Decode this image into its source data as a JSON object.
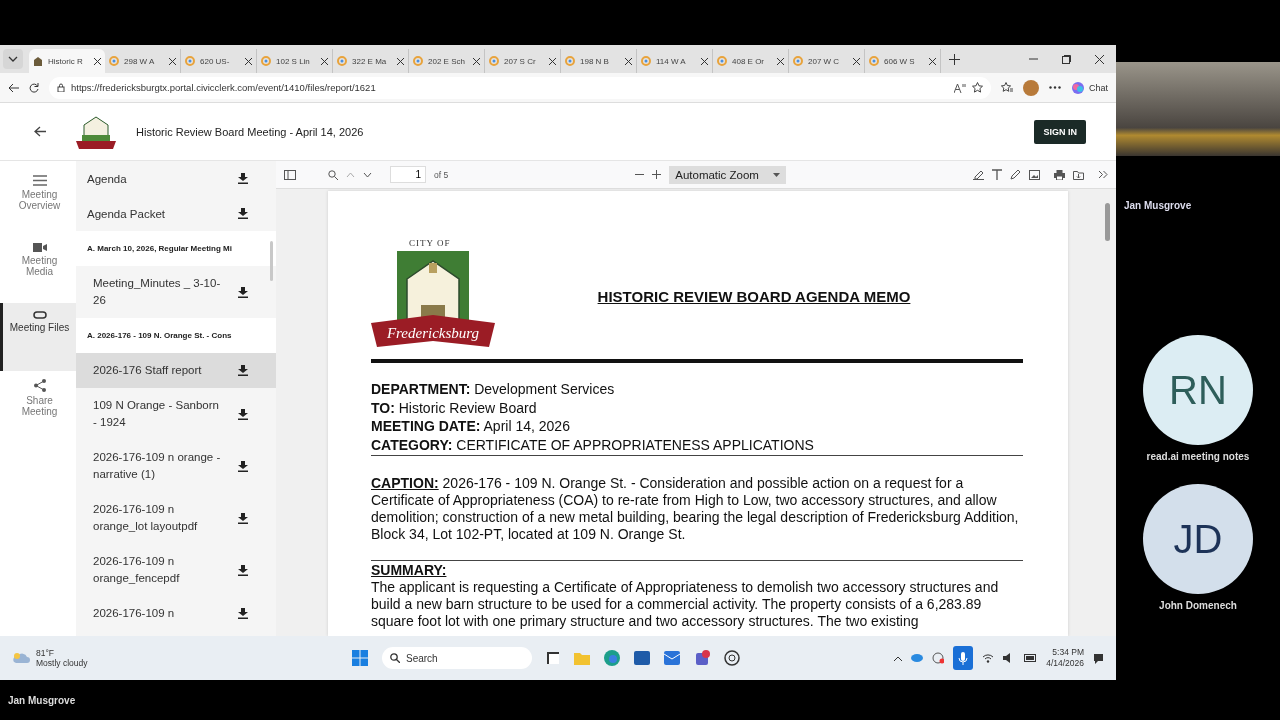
{
  "browser": {
    "tabs": [
      {
        "title": "Historic R",
        "selected": true
      },
      {
        "title": "298 W A",
        "selected": false
      },
      {
        "title": "620 US-",
        "selected": false
      },
      {
        "title": "102 S Lin",
        "selected": false
      },
      {
        "title": "322 E Ma",
        "selected": false
      },
      {
        "title": "202 E Sch",
        "selected": false
      },
      {
        "title": "207 S Cr",
        "selected": false
      },
      {
        "title": "198 N B",
        "selected": false
      },
      {
        "title": "114 W A",
        "selected": false
      },
      {
        "title": "408 E Or",
        "selected": false
      },
      {
        "title": "207 W C",
        "selected": false
      },
      {
        "title": "606 W S",
        "selected": false
      }
    ],
    "address": "https://fredericksburgtx.portal.civicclerk.com/event/1410/files/report/1621",
    "chat": "Chat"
  },
  "site_header": {
    "title": "Historic Review Board Meeting - April 14, 2026",
    "sign_in": "SIGN IN"
  },
  "nav": [
    {
      "kind": "menu",
      "label": "Meeting Overview",
      "selected": false
    },
    {
      "kind": "video",
      "label": "Meeting Media",
      "selected": false
    },
    {
      "kind": "clip",
      "label": "Meeting Files",
      "selected": true
    },
    {
      "kind": "share",
      "label": "Share Meeting",
      "selected": false
    }
  ],
  "files": [
    {
      "kind": "document",
      "name": "Agenda",
      "selected": false
    },
    {
      "kind": "document",
      "name": "Agenda Packet",
      "selected": false
    },
    {
      "kind": "heading",
      "name": "A. March 10, 2026, Regular Meeting Mi"
    },
    {
      "kind": "attachment",
      "name": "Meeting_Minutes _ 3-10-26",
      "selected": false
    },
    {
      "kind": "heading",
      "name": "A. 2026-176 - 109 N. Orange St. - Cons"
    },
    {
      "kind": "attachment",
      "name": "2026-176 Staff report",
      "selected": true
    },
    {
      "kind": "attachment",
      "name": "109 N Orange - Sanborn - 1924",
      "selected": false
    },
    {
      "kind": "attachment",
      "name": "2026-176-109 n orange - narrative (1)",
      "selected": false
    },
    {
      "kind": "attachment",
      "name": "2026-176-109 n orange_lot layoutpdf",
      "selected": false
    },
    {
      "kind": "attachment",
      "name": "2026-176-109 n orange_fencepdf",
      "selected": false
    },
    {
      "kind": "attachment",
      "name": "2026-176-109 n",
      "selected": false
    }
  ],
  "viewer": {
    "page": "1",
    "page_count": "of 5",
    "zoom": "Automatic Zoom"
  },
  "memo": {
    "logo_top": "CITY OF",
    "logo_ribbon": "Fredericksburg",
    "title": "HISTORIC REVIEW BOARD AGENDA MEMO",
    "fields": [
      "**DEPARTMENT:** Development Services",
      "**TO:** Historic Review Board",
      "**MEETING DATE:** April 14, 2026",
      "**CATEGORY:** CERTIFICATE OF APPROPRIATENESS APPLICATIONS"
    ],
    "caption": "**CAPTION:** 2026-176 - 109 N. Orange St. - Consideration and possible action on a request for a Certificate of Appropriateness (COA) to re-rate from High to Low, two accessory structures, and allow demolition; construction of a new metal building, bearing the legal description of Fredericksburg Addition, Block 34, Lot 102-PT, located at 109 N. Orange St.",
    "summary_heading": "SUMMARY:",
    "summary": "The applicant is requesting a Certificate of Appropriateness to demolish two accessory structures and build a new barn structure to be used for a commercial activity. The property consists of a 6,283.89 square foot lot with one primary structure and two accessory structures.  The two existing"
  },
  "taskbar": {
    "temperature": "81°F",
    "weather": "Mostly cloudy",
    "search": "Search",
    "time": "5:34 PM",
    "date": "4/14/2026"
  },
  "call": {
    "participants": [
      {
        "kind": "video",
        "name": "Jan Musgrove"
      },
      {
        "kind": "avatar",
        "initials": "RN",
        "name": "read.ai meeting notes",
        "color": "#dcedf3"
      },
      {
        "kind": "avatar",
        "initials": "JD",
        "name": "John Domenech",
        "color": "#d3dfeb"
      }
    ],
    "footer_name": "Jan Musgrove"
  }
}
